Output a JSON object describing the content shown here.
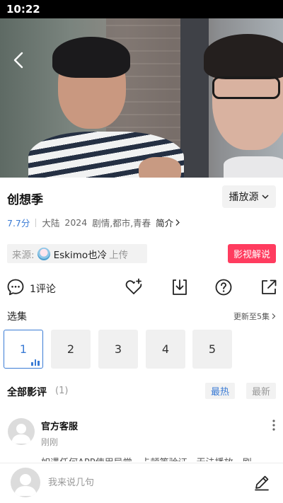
{
  "status_bar": {
    "time": "10:22"
  },
  "video": {
    "back_icon": "chevron-left-icon"
  },
  "show": {
    "title": "创想季",
    "source_button_label": "播放源",
    "rating": "7.7分",
    "region": "大陆",
    "year": "2024",
    "genres": "剧情,都市,青春",
    "intro_label": "简介"
  },
  "uploader": {
    "prefix": "来源:",
    "name": "Eskimo也冷",
    "suffix": "上传"
  },
  "explain_button_label": "影视解说",
  "actions": {
    "comment_count_label": "1评论",
    "icons": [
      "comment-icon",
      "favorite-add-icon",
      "download-icon",
      "help-icon",
      "share-icon"
    ]
  },
  "episodes": {
    "title": "选集",
    "update_label": "更新至5集",
    "items": [
      "1",
      "2",
      "3",
      "4",
      "5"
    ],
    "active_index": 0
  },
  "reviews": {
    "title": "全部影评",
    "count": "(1)",
    "sort_hot": "最热",
    "sort_new": "最新",
    "items": [
      {
        "user": "官方客服",
        "time": "刚刚",
        "text": "如遇任何APP使用异常、卡顿等验证、无法播放，刷"
      }
    ]
  },
  "bottom_bar": {
    "input_placeholder": "我来说几句"
  },
  "colors": {
    "accent_blue": "#3a7bd5",
    "accent_red": "#ff3c5f",
    "chip_bg": "#f2f2f2"
  }
}
